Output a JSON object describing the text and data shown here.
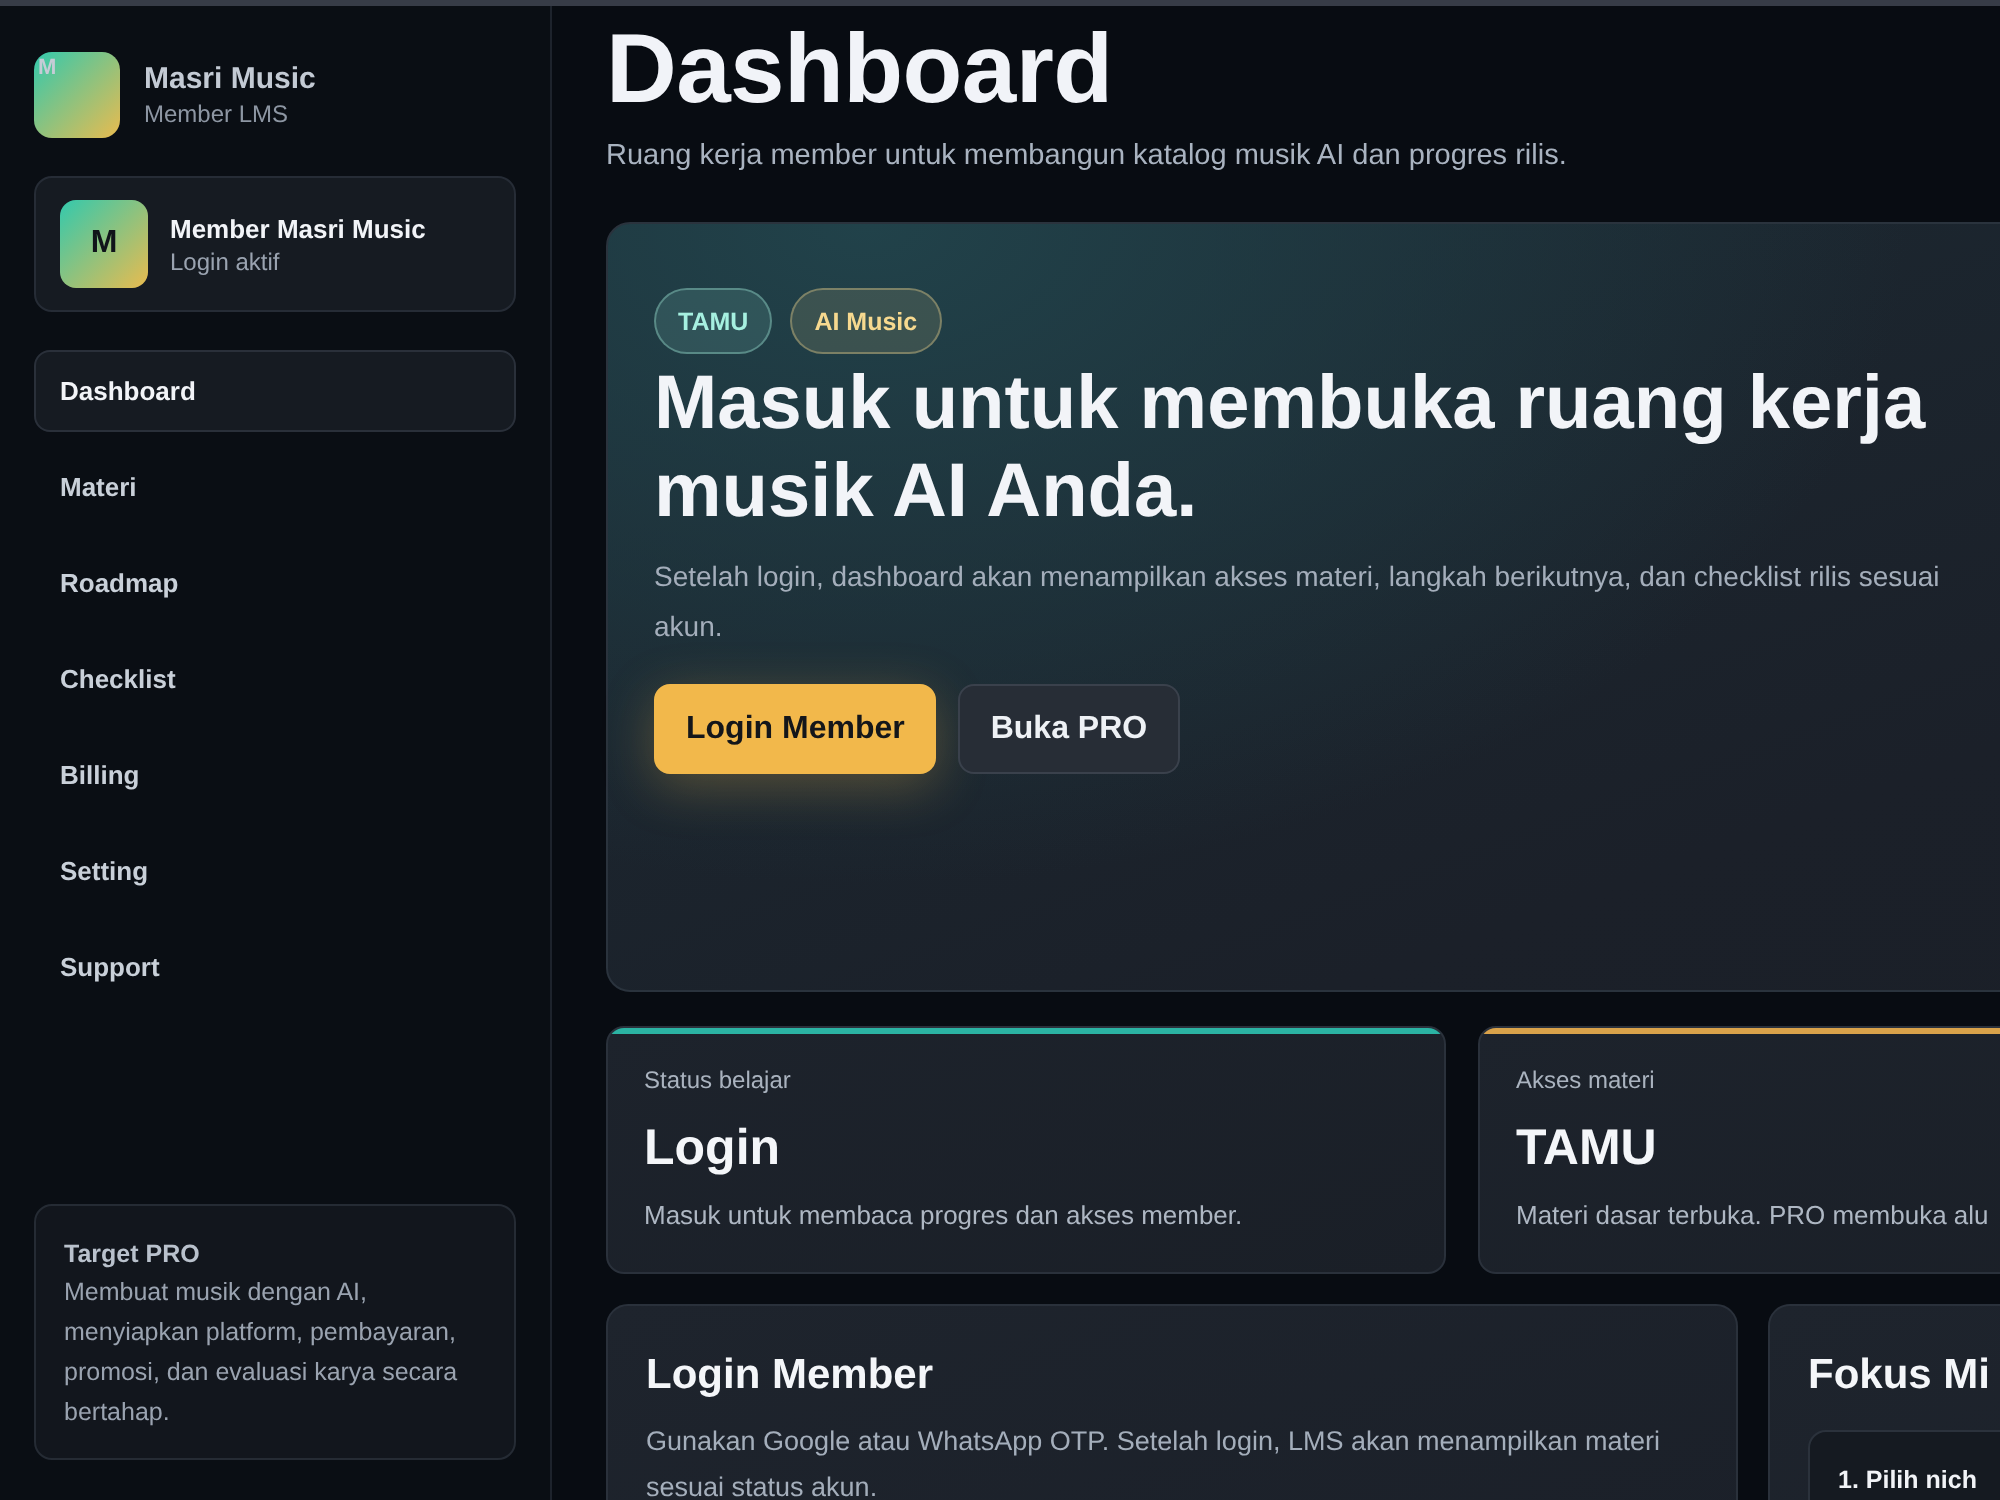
{
  "sidebar": {
    "brand": {
      "logo_text": "M",
      "name": "Masri Music",
      "subtitle": "Member LMS"
    },
    "user": {
      "avatar": "M",
      "name": "Member Masri Music",
      "status": "Login aktif"
    },
    "nav": [
      {
        "label": "Dashboard",
        "selected": true
      },
      {
        "label": "Materi",
        "selected": false
      },
      {
        "label": "Roadmap",
        "selected": false
      },
      {
        "label": "Checklist",
        "selected": false
      },
      {
        "label": "Billing",
        "selected": false
      },
      {
        "label": "Setting",
        "selected": false
      },
      {
        "label": "Support",
        "selected": false
      }
    ],
    "promo": {
      "title": "Target PRO",
      "text": "Membuat musik dengan AI, menyiapkan platform, pembayaran, promosi, dan evaluasi karya secara bertahap."
    }
  },
  "header": {
    "title": "Dashboard",
    "subtitle": "Ruang kerja member untuk membangun katalog musik AI dan progres rilis."
  },
  "hero": {
    "badges": [
      {
        "label": "TAMU",
        "color": "#a6f0e0"
      },
      {
        "label": "AI Music",
        "color": "#f7d98f"
      }
    ],
    "title": "Masuk untuk membuka ruang kerja musik AI Anda.",
    "text": "Setelah login, dashboard akan menampilkan akses materi, langkah berikutnya, dan checklist rilis sesuai akun.",
    "buttons": [
      {
        "label": "Login Member",
        "kind": "primary"
      },
      {
        "label": "Buka PRO",
        "kind": "secondary"
      }
    ]
  },
  "stats": [
    {
      "label": "Status belajar",
      "value": "Login",
      "text": "Masuk untuk membaca progres dan akses member.",
      "color": "#2bb3a3"
    },
    {
      "label": "Akses materi",
      "value": "TAMU",
      "text": "Materi dasar terbuka. PRO membuka alu",
      "color": "#d9a24a"
    }
  ],
  "panels": [
    {
      "title": "Login Member",
      "text": "Gunakan Google atau WhatsApp OTP. Setelah login, LMS akan menampilkan materi sesuai status akun."
    },
    {
      "title": "Fokus Mi",
      "steps": [
        "1. Pilih nich"
      ]
    }
  ]
}
